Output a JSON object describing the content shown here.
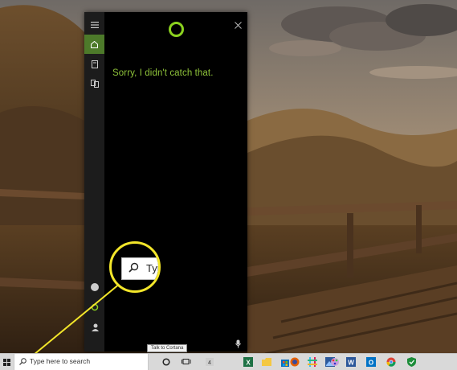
{
  "cortana": {
    "message": "Sorry, I didn't catch that.",
    "accent_color": "#8bd11f",
    "rail_items": [
      "hamburger-icon",
      "home-icon",
      "notebook-icon",
      "collections-icon",
      "feedback-icon",
      "settings-icon",
      "account-icon"
    ],
    "active_rail_item": "home-icon"
  },
  "magnifier": {
    "text": "Typ",
    "highlight_color": "#f3e62a"
  },
  "taskbar": {
    "search_placeholder": "Type here to search",
    "tooltip": "Talk to Cortana",
    "pinned_apps": [
      "cortana-icon",
      "task-view-icon",
      "app-number-icon",
      "excel-icon",
      "folder-icon",
      "store-icon",
      "firefox-icon",
      "slack-icon",
      "photos-icon",
      "paint-icon",
      "word-icon",
      "outlook-icon",
      "chrome-icon",
      "windows-defender-icon"
    ]
  }
}
